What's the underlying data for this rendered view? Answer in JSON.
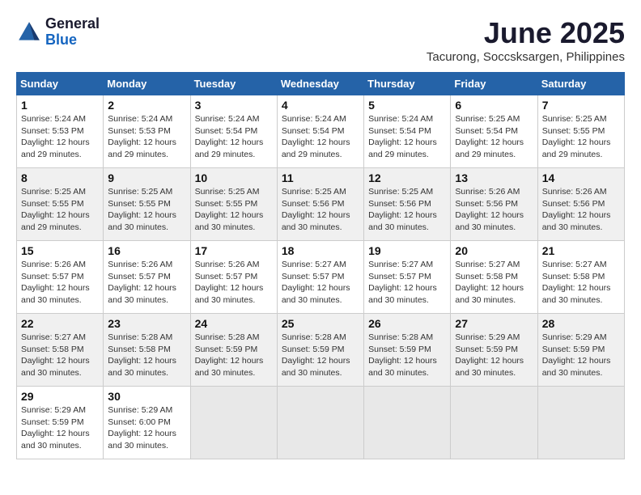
{
  "logo": {
    "general": "General",
    "blue": "Blue"
  },
  "title": "June 2025",
  "subtitle": "Tacurong, Soccsksargen, Philippines",
  "weekdays": [
    "Sunday",
    "Monday",
    "Tuesday",
    "Wednesday",
    "Thursday",
    "Friday",
    "Saturday"
  ],
  "weeks": [
    [
      {
        "day": "1",
        "info": "Sunrise: 5:24 AM\nSunset: 5:53 PM\nDaylight: 12 hours\nand 29 minutes."
      },
      {
        "day": "2",
        "info": "Sunrise: 5:24 AM\nSunset: 5:53 PM\nDaylight: 12 hours\nand 29 minutes."
      },
      {
        "day": "3",
        "info": "Sunrise: 5:24 AM\nSunset: 5:54 PM\nDaylight: 12 hours\nand 29 minutes."
      },
      {
        "day": "4",
        "info": "Sunrise: 5:24 AM\nSunset: 5:54 PM\nDaylight: 12 hours\nand 29 minutes."
      },
      {
        "day": "5",
        "info": "Sunrise: 5:24 AM\nSunset: 5:54 PM\nDaylight: 12 hours\nand 29 minutes."
      },
      {
        "day": "6",
        "info": "Sunrise: 5:25 AM\nSunset: 5:54 PM\nDaylight: 12 hours\nand 29 minutes."
      },
      {
        "day": "7",
        "info": "Sunrise: 5:25 AM\nSunset: 5:55 PM\nDaylight: 12 hours\nand 29 minutes."
      }
    ],
    [
      {
        "day": "8",
        "info": "Sunrise: 5:25 AM\nSunset: 5:55 PM\nDaylight: 12 hours\nand 29 minutes."
      },
      {
        "day": "9",
        "info": "Sunrise: 5:25 AM\nSunset: 5:55 PM\nDaylight: 12 hours\nand 30 minutes."
      },
      {
        "day": "10",
        "info": "Sunrise: 5:25 AM\nSunset: 5:55 PM\nDaylight: 12 hours\nand 30 minutes."
      },
      {
        "day": "11",
        "info": "Sunrise: 5:25 AM\nSunset: 5:56 PM\nDaylight: 12 hours\nand 30 minutes."
      },
      {
        "day": "12",
        "info": "Sunrise: 5:25 AM\nSunset: 5:56 PM\nDaylight: 12 hours\nand 30 minutes."
      },
      {
        "day": "13",
        "info": "Sunrise: 5:26 AM\nSunset: 5:56 PM\nDaylight: 12 hours\nand 30 minutes."
      },
      {
        "day": "14",
        "info": "Sunrise: 5:26 AM\nSunset: 5:56 PM\nDaylight: 12 hours\nand 30 minutes."
      }
    ],
    [
      {
        "day": "15",
        "info": "Sunrise: 5:26 AM\nSunset: 5:57 PM\nDaylight: 12 hours\nand 30 minutes."
      },
      {
        "day": "16",
        "info": "Sunrise: 5:26 AM\nSunset: 5:57 PM\nDaylight: 12 hours\nand 30 minutes."
      },
      {
        "day": "17",
        "info": "Sunrise: 5:26 AM\nSunset: 5:57 PM\nDaylight: 12 hours\nand 30 minutes."
      },
      {
        "day": "18",
        "info": "Sunrise: 5:27 AM\nSunset: 5:57 PM\nDaylight: 12 hours\nand 30 minutes."
      },
      {
        "day": "19",
        "info": "Sunrise: 5:27 AM\nSunset: 5:57 PM\nDaylight: 12 hours\nand 30 minutes."
      },
      {
        "day": "20",
        "info": "Sunrise: 5:27 AM\nSunset: 5:58 PM\nDaylight: 12 hours\nand 30 minutes."
      },
      {
        "day": "21",
        "info": "Sunrise: 5:27 AM\nSunset: 5:58 PM\nDaylight: 12 hours\nand 30 minutes."
      }
    ],
    [
      {
        "day": "22",
        "info": "Sunrise: 5:27 AM\nSunset: 5:58 PM\nDaylight: 12 hours\nand 30 minutes."
      },
      {
        "day": "23",
        "info": "Sunrise: 5:28 AM\nSunset: 5:58 PM\nDaylight: 12 hours\nand 30 minutes."
      },
      {
        "day": "24",
        "info": "Sunrise: 5:28 AM\nSunset: 5:59 PM\nDaylight: 12 hours\nand 30 minutes."
      },
      {
        "day": "25",
        "info": "Sunrise: 5:28 AM\nSunset: 5:59 PM\nDaylight: 12 hours\nand 30 minutes."
      },
      {
        "day": "26",
        "info": "Sunrise: 5:28 AM\nSunset: 5:59 PM\nDaylight: 12 hours\nand 30 minutes."
      },
      {
        "day": "27",
        "info": "Sunrise: 5:29 AM\nSunset: 5:59 PM\nDaylight: 12 hours\nand 30 minutes."
      },
      {
        "day": "28",
        "info": "Sunrise: 5:29 AM\nSunset: 5:59 PM\nDaylight: 12 hours\nand 30 minutes."
      }
    ],
    [
      {
        "day": "29",
        "info": "Sunrise: 5:29 AM\nSunset: 5:59 PM\nDaylight: 12 hours\nand 30 minutes."
      },
      {
        "day": "30",
        "info": "Sunrise: 5:29 AM\nSunset: 6:00 PM\nDaylight: 12 hours\nand 30 minutes."
      },
      {
        "day": "",
        "info": ""
      },
      {
        "day": "",
        "info": ""
      },
      {
        "day": "",
        "info": ""
      },
      {
        "day": "",
        "info": ""
      },
      {
        "day": "",
        "info": ""
      }
    ]
  ]
}
